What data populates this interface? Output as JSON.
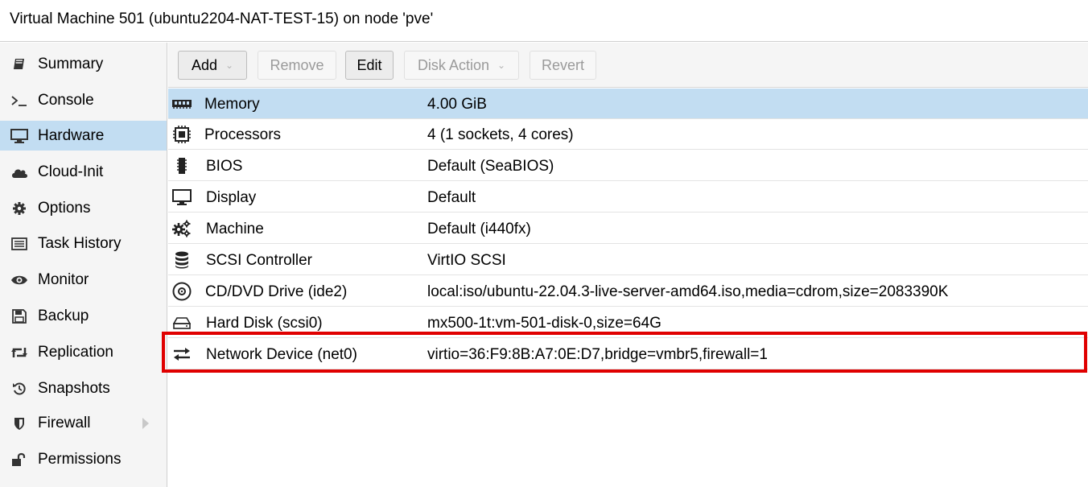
{
  "window": {
    "title": "Virtual Machine 501 (ubuntu2204-NAT-TEST-15) on node 'pve'"
  },
  "sidebar": {
    "items": [
      {
        "label": "Summary",
        "icon": "book-icon"
      },
      {
        "label": "Console",
        "icon": "terminal-icon"
      },
      {
        "label": "Hardware",
        "icon": "monitor-icon",
        "active": true
      },
      {
        "label": "Cloud-Init",
        "icon": "cloud-icon"
      },
      {
        "label": "Options",
        "icon": "gear-icon"
      },
      {
        "label": "Task History",
        "icon": "list-icon"
      },
      {
        "label": "Monitor",
        "icon": "eye-icon"
      },
      {
        "label": "Backup",
        "icon": "floppy-icon"
      },
      {
        "label": "Replication",
        "icon": "retweet-icon"
      },
      {
        "label": "Snapshots",
        "icon": "history-icon"
      },
      {
        "label": "Firewall",
        "icon": "shield-icon",
        "has_submenu": true
      },
      {
        "label": "Permissions",
        "icon": "unlock-icon"
      }
    ]
  },
  "toolbar": {
    "add_label": "Add",
    "remove_label": "Remove",
    "edit_label": "Edit",
    "disk_action_label": "Disk Action",
    "revert_label": "Revert"
  },
  "hardware": {
    "rows": [
      {
        "name": "Memory",
        "value": "4.00 GiB",
        "icon": "memory-icon",
        "selected": true
      },
      {
        "name": "Processors",
        "value": "4 (1 sockets, 4 cores)",
        "icon": "cpu-icon"
      },
      {
        "name": "BIOS",
        "value": "Default (SeaBIOS)",
        "icon": "chip-icon"
      },
      {
        "name": "Display",
        "value": "Default",
        "icon": "display-icon"
      },
      {
        "name": "Machine",
        "value": "Default (i440fx)",
        "icon": "cogs-icon"
      },
      {
        "name": "SCSI Controller",
        "value": "VirtIO SCSI",
        "icon": "database-icon"
      },
      {
        "name": "CD/DVD Drive (ide2)",
        "value": "local:iso/ubuntu-22.04.3-live-server-amd64.iso,media=cdrom,size=2083390K",
        "icon": "cdrom-icon"
      },
      {
        "name": "Hard Disk (scsi0)",
        "value": "mx500-1t:vm-501-disk-0,size=64G",
        "icon": "hdd-icon"
      },
      {
        "name": "Network Device (net0)",
        "value": "virtio=36:F9:8B:A7:0E:D7,bridge=vmbr5,firewall=1",
        "icon": "exchange-icon"
      }
    ]
  },
  "colors": {
    "selection": "#c2ddf2",
    "highlight_box": "#e00000",
    "panel_bg": "#f5f5f5"
  }
}
